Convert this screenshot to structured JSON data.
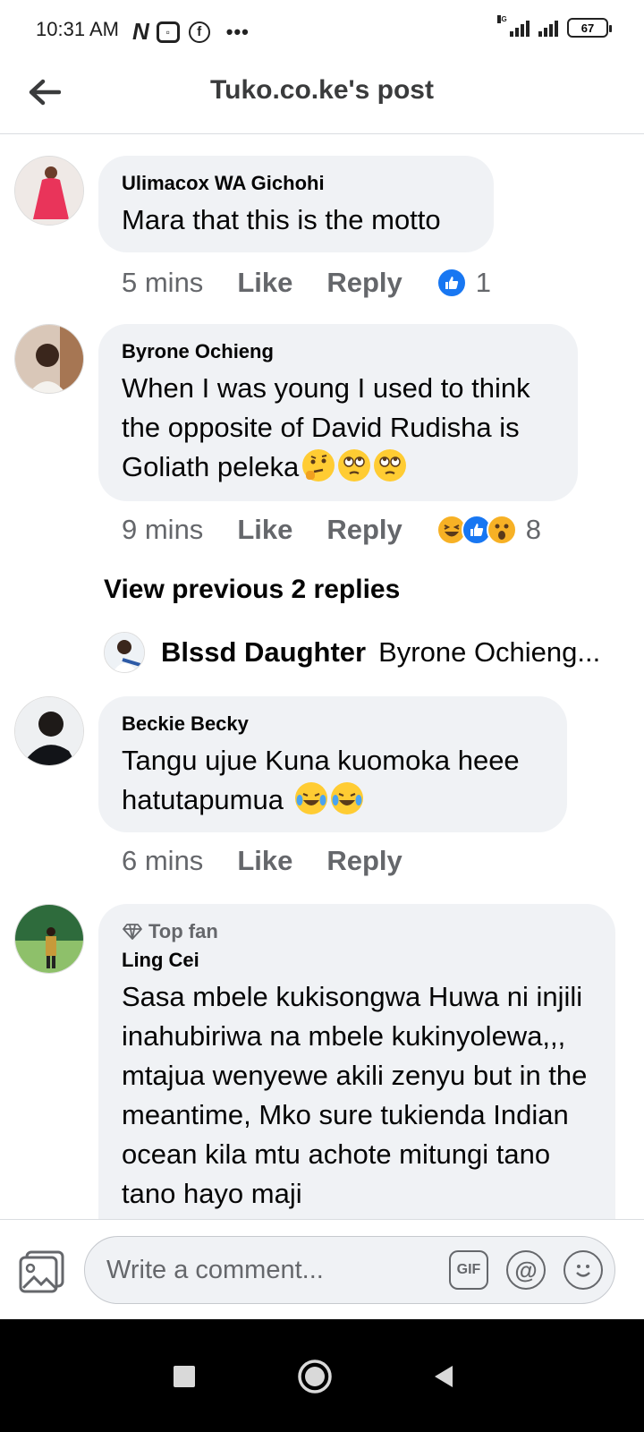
{
  "status_bar": {
    "time": "10:31 AM",
    "left_icons": [
      "news-app-icon",
      "screen-record-icon",
      "facebook-icon",
      "more-dots-icon"
    ],
    "network_tag": "4G",
    "battery": "67"
  },
  "header": {
    "title": "Tuko.co.ke's post",
    "back_icon": "back-arrow-icon"
  },
  "comments": [
    {
      "author": "Ulimacox WA Gichohi",
      "text": "Mara that this is the motto",
      "time": "5 mins",
      "like_label": "Like",
      "reply_label": "Reply",
      "reactions": [
        "like"
      ],
      "reaction_count": "1"
    },
    {
      "author": "Byrone Ochieng",
      "text": "When I was young I used to think the opposite of David Rudisha is Goliath peleka",
      "emojis": [
        "thinking-face",
        "eye-roll-face",
        "eye-roll-face"
      ],
      "time": "9 mins",
      "like_label": "Like",
      "reply_label": "Reply",
      "reactions": [
        "haha",
        "like",
        "wow"
      ],
      "reaction_count": "8",
      "view_previous": "View previous 2 replies",
      "latest_reply": {
        "author": "Blssd Daughter",
        "preview": "Byrone Ochieng..."
      }
    },
    {
      "author": "Beckie Becky",
      "text": "Tangu ujue Kuna kuomoka heee hatutapumua",
      "emojis": [
        "tears-of-joy",
        "tears-of-joy"
      ],
      "time": "6 mins",
      "like_label": "Like",
      "reply_label": "Reply"
    },
    {
      "badge": "Top fan",
      "author": "Ling Cei",
      "text": "Sasa mbele kukisongwa Huwa ni injili inahubiriwa na mbele kukinyolewa,,, mtajua wenyewe akili zenyu but in the meantime, Mko sure tukienda Indian ocean kila mtu achote mitungi tano tano hayo maji"
    }
  ],
  "composer": {
    "placeholder": "Write a comment...",
    "gif_label": "GIF",
    "at_label": "@"
  },
  "colors": {
    "bubble": "#f0f2f5",
    "meta_text": "#65676b",
    "like_blue": "#1877f2",
    "reaction_yellow": "#f7b125"
  }
}
